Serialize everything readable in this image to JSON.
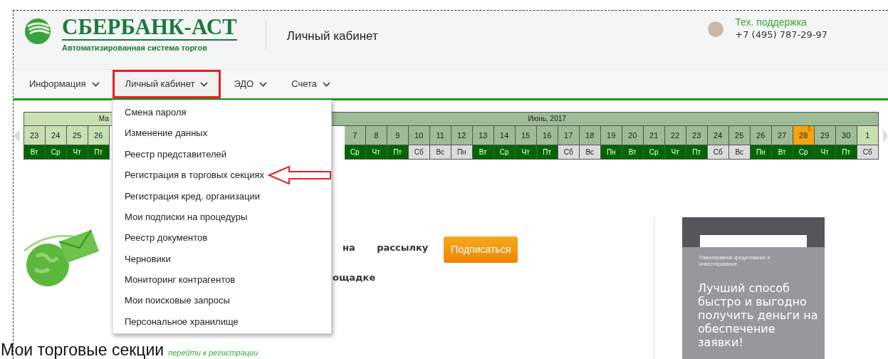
{
  "logo": {
    "name": "СБЕРБАНК-АСТ",
    "tagline": "Автоматизированная система торгов"
  },
  "header_title": "Личный кабинет",
  "support": {
    "label": "Тех. поддержка",
    "phone": "+7 (495) 787-29-97"
  },
  "nav": [
    {
      "label": "Информация",
      "selected": false
    },
    {
      "label": "Личный кабинет",
      "selected": true
    },
    {
      "label": "ЭДО",
      "selected": false
    },
    {
      "label": "Счета",
      "selected": false
    }
  ],
  "dropdown": [
    {
      "label": "Смена пароля",
      "marked": false
    },
    {
      "label": "Изменение данных",
      "marked": false
    },
    {
      "label": "Реестр представителей",
      "marked": false
    },
    {
      "label": "Регистрация в торговых секциях",
      "marked": true
    },
    {
      "label": "Регистрация кред. организации",
      "marked": false
    },
    {
      "label": "Мои подписки на процедуры",
      "marked": false
    },
    {
      "label": "Реестр документов",
      "marked": false
    },
    {
      "label": "Черновики",
      "marked": false
    },
    {
      "label": "Мониторинг контрагентов",
      "marked": false
    },
    {
      "label": "Мои поисковые запросы",
      "marked": false
    },
    {
      "label": "Персональное хранилище",
      "marked": false
    }
  ],
  "calendar": {
    "months": [
      {
        "title": "Ма",
        "days": [
          {
            "date": "23",
            "weekday": "Вт",
            "kind": "prev",
            "day_off": false
          },
          {
            "date": "24",
            "weekday": "Ср",
            "kind": "prev",
            "day_off": false
          },
          {
            "date": "25",
            "weekday": "Чт",
            "kind": "prev",
            "day_off": false
          },
          {
            "date": "26",
            "weekday": "Пт",
            "kind": "prev",
            "day_off": false
          }
        ]
      },
      {
        "title": "Июнь, 2017",
        "days": [
          {
            "date": "7",
            "weekday": "Ср",
            "kind": "cur",
            "day_off": false
          },
          {
            "date": "8",
            "weekday": "Чт",
            "kind": "cur",
            "day_off": false
          },
          {
            "date": "9",
            "weekday": "Пт",
            "kind": "cur",
            "day_off": false
          },
          {
            "date": "10",
            "weekday": "Сб",
            "kind": "cur",
            "day_off": true
          },
          {
            "date": "11",
            "weekday": "Вс",
            "kind": "cur",
            "day_off": true
          },
          {
            "date": "12",
            "weekday": "Пн",
            "kind": "cur",
            "day_off": true
          },
          {
            "date": "13",
            "weekday": "Вт",
            "kind": "cur",
            "day_off": false
          },
          {
            "date": "14",
            "weekday": "Ср",
            "kind": "cur",
            "day_off": false
          },
          {
            "date": "15",
            "weekday": "Чт",
            "kind": "cur",
            "day_off": false
          },
          {
            "date": "16",
            "weekday": "Пт",
            "kind": "cur",
            "day_off": false
          },
          {
            "date": "17",
            "weekday": "Сб",
            "kind": "cur",
            "day_off": true
          },
          {
            "date": "18",
            "weekday": "Вс",
            "kind": "cur",
            "day_off": true
          },
          {
            "date": "19",
            "weekday": "Пн",
            "kind": "cur",
            "day_off": false
          },
          {
            "date": "20",
            "weekday": "Вт",
            "kind": "cur",
            "day_off": false
          },
          {
            "date": "21",
            "weekday": "Ср",
            "kind": "cur",
            "day_off": false
          },
          {
            "date": "22",
            "weekday": "Чт",
            "kind": "cur",
            "day_off": false
          },
          {
            "date": "23",
            "weekday": "Пт",
            "kind": "cur",
            "day_off": false
          },
          {
            "date": "24",
            "weekday": "Сб",
            "kind": "cur",
            "day_off": true
          },
          {
            "date": "25",
            "weekday": "Вс",
            "kind": "cur",
            "day_off": true
          },
          {
            "date": "26",
            "weekday": "Пн",
            "kind": "cur",
            "day_off": false
          },
          {
            "date": "27",
            "weekday": "Вт",
            "kind": "cur",
            "day_off": false
          },
          {
            "date": "28",
            "weekday": "Ср",
            "kind": "today",
            "day_off": false,
            "badge": "1"
          },
          {
            "date": "29",
            "weekday": "Чт",
            "kind": "cur",
            "day_off": false
          },
          {
            "date": "30",
            "weekday": "Пт",
            "kind": "cur",
            "day_off": false
          },
          {
            "date": "1",
            "weekday": "Сб",
            "kind": "next",
            "day_off": true
          }
        ]
      }
    ]
  },
  "subscribe": {
    "line_1": "на рассылку",
    "line_2": "ощадке",
    "button": "Подписаться"
  },
  "ad": {
    "small": "Равноправное кредитование и инвестирование",
    "headline": "Лучший способ быстро и выгодно получить деньги на обеспечение заявки!"
  },
  "sections": {
    "title": "Мои торговые секции",
    "link": "перейти к регистрации"
  }
}
